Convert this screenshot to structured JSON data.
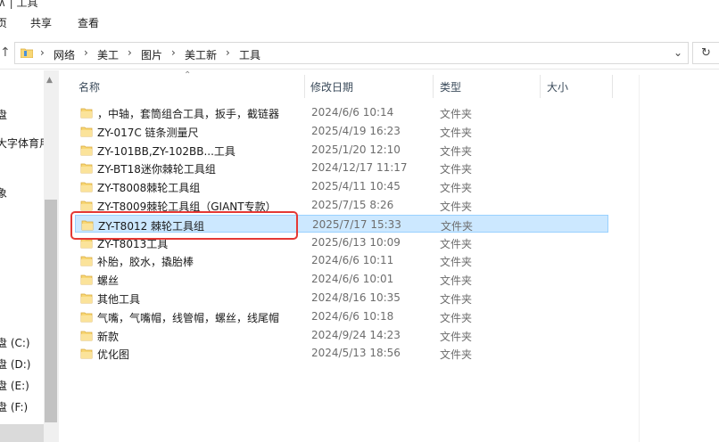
{
  "ribbon": {
    "partial_title": "∧ | 工具",
    "tabs": [
      "页",
      "共享",
      "查看"
    ]
  },
  "address": {
    "crumbs": [
      "网络",
      "美工",
      "图片",
      "美工新",
      "工具"
    ],
    "separator": "›"
  },
  "nav": {
    "items": [
      "盘",
      "大字体育用",
      "象",
      "盘 (C:)",
      "盘 (D:)",
      "盘 (E:)",
      "盘 (F:)"
    ]
  },
  "columns": {
    "name": "名称",
    "modified": "修改日期",
    "type": "类型",
    "size": "大小"
  },
  "files": [
    {
      "name": "，中轴，套筒组合工具，扳手，截链器",
      "date": "2024/6/6 10:14",
      "type": "文件夹"
    },
    {
      "name": "ZY-017C  链条测量尺",
      "date": "2025/4/19 16:23",
      "type": "文件夹"
    },
    {
      "name": "ZY-101BB,ZY-102BB...工具",
      "date": "2025/1/20 12:10",
      "type": "文件夹"
    },
    {
      "name": "ZY-BT18迷你棘轮工具组",
      "date": "2024/12/17 11:17",
      "type": "文件夹"
    },
    {
      "name": "ZY-T8008棘轮工具组",
      "date": "2025/4/11 10:45",
      "type": "文件夹"
    },
    {
      "name": "ZY-T8009棘轮工具组（GIANT专款）",
      "date": "2025/7/15 8:26",
      "type": "文件夹"
    },
    {
      "name": "ZY-T8012 棘轮工具组",
      "date": "2025/7/17 15:33",
      "type": "文件夹",
      "selected": true
    },
    {
      "name": "ZY-T8013工具",
      "date": "2025/6/13 10:09",
      "type": "文件夹"
    },
    {
      "name": "补胎，胶水，撬胎棒",
      "date": "2024/6/6 10:11",
      "type": "文件夹"
    },
    {
      "name": "螺丝",
      "date": "2024/6/6 10:01",
      "type": "文件夹"
    },
    {
      "name": "其他工具",
      "date": "2024/8/16 10:35",
      "type": "文件夹"
    },
    {
      "name": "气嘴，气嘴帽，线管帽，螺丝，线尾帽",
      "date": "2024/6/6 10:18",
      "type": "文件夹"
    },
    {
      "name": "新款",
      "date": "2024/9/24 14:23",
      "type": "文件夹"
    },
    {
      "name": "优化图",
      "date": "2024/5/13 18:56",
      "type": "文件夹"
    }
  ],
  "colors": {
    "selection_bg": "#cce8ff",
    "selection_border": "#99d1ff",
    "highlight_box": "#e53935",
    "folder_yellow": "#f8d775"
  }
}
